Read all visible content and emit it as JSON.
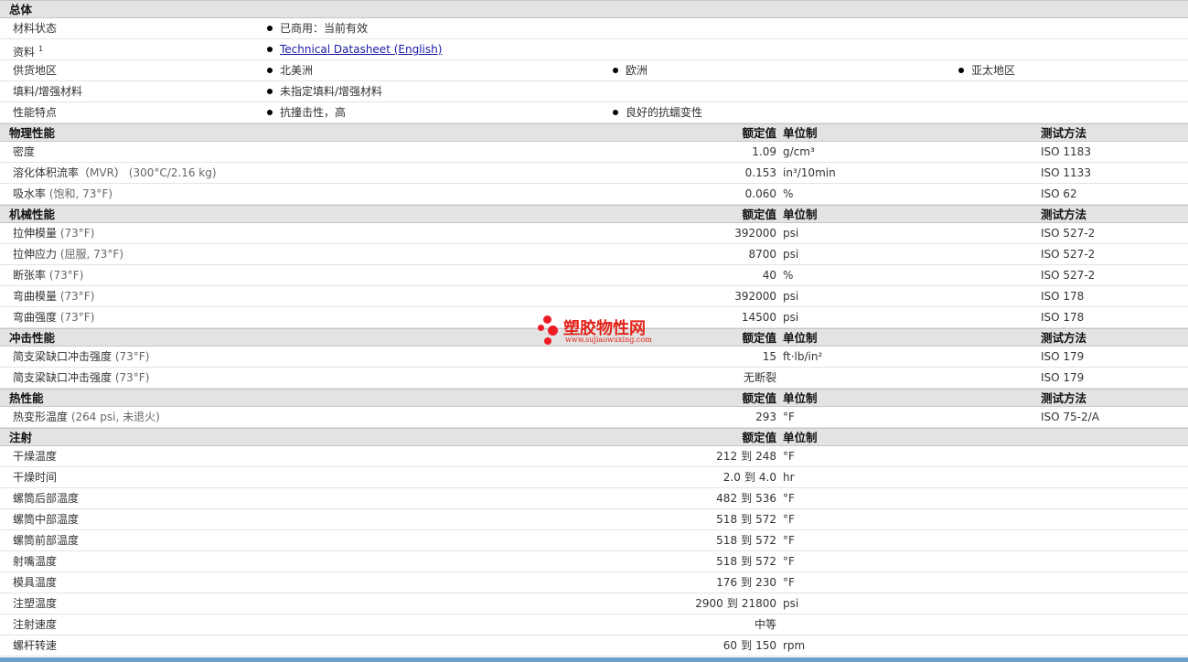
{
  "general": {
    "header": "总体",
    "rows": [
      {
        "label": "材料状态",
        "items": [
          "已商用：当前有效"
        ]
      },
      {
        "label": "资料",
        "sup": "1",
        "link": "Technical Datasheet (English)"
      },
      {
        "label": "供货地区",
        "items": [
          "北美洲",
          "欧洲",
          "亚太地区"
        ]
      },
      {
        "label": "填料/增强材料",
        "items": [
          "未指定填料/增强材料"
        ]
      },
      {
        "label": "性能特点",
        "items": [
          "抗撞击性，高",
          "良好的抗蠕变性"
        ]
      }
    ]
  },
  "col_headers": {
    "value": "额定值",
    "unit": "单位制",
    "method": "测试方法"
  },
  "physical": {
    "header": "物理性能",
    "rows": [
      {
        "name": "密度",
        "cond": "",
        "value": "1.09",
        "unit": "g/cm³",
        "method": "ISO 1183"
      },
      {
        "name": "溶化体积流率（",
        "name2": "MVR",
        "name3": "）",
        "cond": "(300°C/2.16 kg)",
        "value": "0.153",
        "unit": "in³/10min",
        "method": "ISO 1133"
      },
      {
        "name": "吸水率",
        "cond": "(饱和, 73°F)",
        "value": "0.060",
        "unit": "%",
        "method": "ISO 62"
      }
    ]
  },
  "mechanical": {
    "header": "机械性能",
    "rows": [
      {
        "name": "拉伸模量",
        "cond": "(73°F)",
        "value": "392000",
        "unit": "psi",
        "method": "ISO 527-2"
      },
      {
        "name": "拉伸应力",
        "cond": "(屈服, 73°F)",
        "value": "8700",
        "unit": "psi",
        "method": "ISO 527-2"
      },
      {
        "name": "断张率",
        "cond": "(73°F)",
        "value": "40",
        "unit": "%",
        "method": "ISO 527-2"
      },
      {
        "name": "弯曲模量",
        "cond": "(73°F)",
        "value": "392000",
        "unit": "psi",
        "method": "ISO 178"
      },
      {
        "name": "弯曲强度",
        "cond": "(73°F)",
        "value": "14500",
        "unit": "psi",
        "method": "ISO 178"
      }
    ]
  },
  "impact": {
    "header": "冲击性能",
    "rows": [
      {
        "name": "简支梁缺口冲击强度",
        "cond": "(73°F)",
        "value": "15",
        "unit": "ft·lb/in²",
        "method": "ISO 179"
      },
      {
        "name": "简支梁缺口冲击强度",
        "cond": "(73°F)",
        "value": "无断裂",
        "unit": "",
        "method": "ISO 179"
      }
    ]
  },
  "thermal": {
    "header": "热性能",
    "rows": [
      {
        "name": "热变形温度",
        "cond": "(264 psi, 未退火)",
        "value": "293",
        "unit": "°F",
        "method": "ISO 75-2/A"
      }
    ]
  },
  "injection": {
    "header": "注射",
    "to": "到",
    "rows": [
      {
        "name": "干燥温度",
        "min": "212",
        "max": "248",
        "unit": "°F"
      },
      {
        "name": "干燥时间",
        "min": "2.0",
        "max": "4.0",
        "unit": "hr"
      },
      {
        "name": "螺筒后部温度",
        "min": "482",
        "max": "536",
        "unit": "°F"
      },
      {
        "name": "螺筒中部温度",
        "min": "518",
        "max": "572",
        "unit": "°F"
      },
      {
        "name": "螺筒前部温度",
        "min": "518",
        "max": "572",
        "unit": "°F"
      },
      {
        "name": "射嘴温度",
        "min": "518",
        "max": "572",
        "unit": "°F"
      },
      {
        "name": "模具温度",
        "min": "176",
        "max": "230",
        "unit": "°F"
      },
      {
        "name": "注塑温度",
        "min": "2900",
        "max": "21800",
        "unit": "psi"
      },
      {
        "name": "注射速度",
        "single": "中等",
        "unit": ""
      },
      {
        "name": "螺杆转速",
        "min": "60",
        "max": "150",
        "unit": "rpm"
      }
    ]
  },
  "watermark": {
    "brand": "塑胶物性网",
    "url": "www.sujiaowuxing.com"
  },
  "colors": {
    "header_bg": "#e3e3e3",
    "link": "#1a1aa6",
    "logo_red": "#ee1c24"
  }
}
